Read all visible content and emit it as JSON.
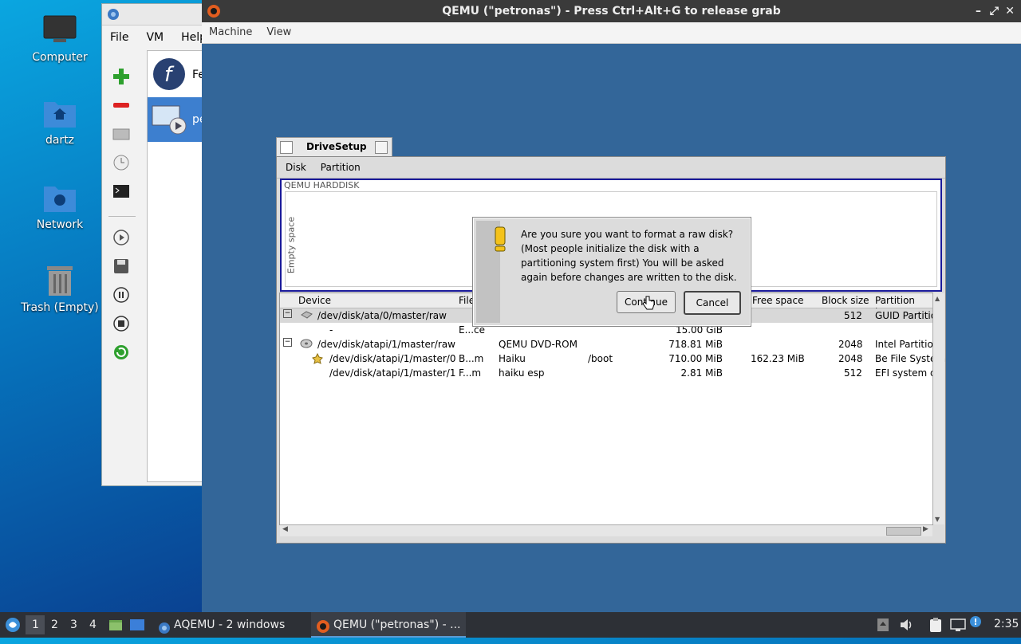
{
  "desktop": {
    "icons": [
      {
        "label": "Computer"
      },
      {
        "label": "dartz"
      },
      {
        "label": "Network"
      },
      {
        "label": "Trash (Empty)"
      }
    ]
  },
  "aqemu": {
    "menu": [
      "File",
      "VM",
      "Help"
    ],
    "vms": [
      {
        "label": "Fe"
      },
      {
        "label": "pe"
      }
    ]
  },
  "qemu": {
    "title": "QEMU (\"petronas\") - Press Ctrl+Alt+G to release grab",
    "menu": [
      "Machine",
      "View"
    ]
  },
  "drivesetup": {
    "title": "DriveSetup",
    "menu": [
      "Disk",
      "Partition"
    ],
    "disk_label": "QEMU HARDDISK",
    "empty_label": "Empty space",
    "columns": [
      "Device",
      "File",
      "Free space",
      "Block size",
      "Partition type"
    ],
    "rows": [
      {
        "device": "/dev/disk/ata/0/master/raw",
        "file": "",
        "name": "",
        "mount": "",
        "size": "",
        "free": "",
        "block": "512",
        "ptype": "GUID Partition"
      },
      {
        "device": "-",
        "file": "E...ce",
        "name": "",
        "mount": "",
        "size": "15.00 GiB",
        "free": "",
        "block": "",
        "ptype": ""
      },
      {
        "device": "/dev/disk/atapi/1/master/raw",
        "file": "",
        "name": "QEMU DVD-ROM",
        "mount": "",
        "size": "718.81 MiB",
        "free": "",
        "block": "2048",
        "ptype": "Intel Partition"
      },
      {
        "device": "/dev/disk/atapi/1/master/0",
        "file": "B...m",
        "name": "Haiku",
        "mount": "/boot",
        "size": "710.00 MiB",
        "free": "162.23 MiB",
        "block": "2048",
        "ptype": "Be File System"
      },
      {
        "device": "/dev/disk/atapi/1/master/1",
        "file": "F...m",
        "name": "haiku esp",
        "mount": "",
        "size": "2.81 MiB",
        "free": "",
        "block": "512",
        "ptype": "EFI system da"
      }
    ]
  },
  "dialog": {
    "message": "Are you sure you want to format a raw disk? (Most people initialize the disk with a partitioning system first) You will be asked again before changes are written to the disk.",
    "continue_label": "Continue",
    "cancel_label": "Cancel"
  },
  "taskbar": {
    "workspaces": [
      "1",
      "2",
      "3",
      "4"
    ],
    "tasks": [
      {
        "label": "AQEMU - 2 windows"
      },
      {
        "label": "QEMU (\"petronas\") - ..."
      }
    ],
    "clock": "2:35"
  },
  "colors": {
    "qemu_bg": "#336699",
    "haiku_focus": "#1a1a9a",
    "taskbar": "#2d3036"
  }
}
